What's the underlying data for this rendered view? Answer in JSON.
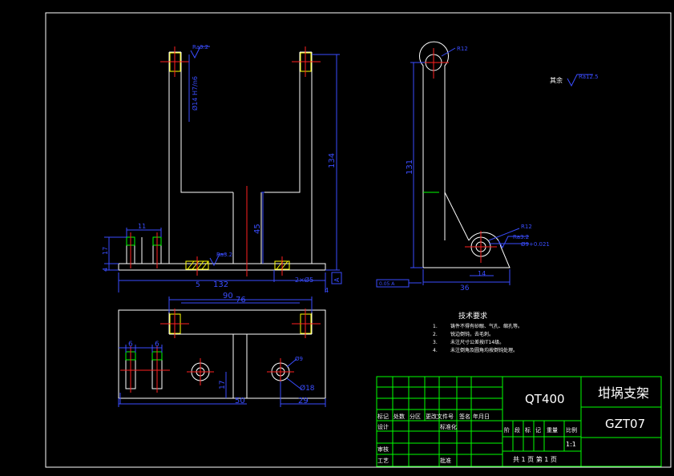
{
  "colors": {
    "background": "#000000",
    "part": "#ffffff",
    "dimension": "#3a4dff",
    "centerline": "#ff2020",
    "highlight": "#ffff00",
    "section": "#00ff00",
    "titleblock": "#00ff00"
  },
  "dimensions": {
    "front_width_132": "132",
    "front_inner_76": "76",
    "front_shaft_90": "90",
    "front_height_134": "134",
    "front_post_45": "45",
    "front_hole_fit": "Ø14 H7/n6",
    "front_base_17": "17",
    "front_base_4": "4",
    "front_lug_11": "11",
    "front_offset_5": "5",
    "front_right_4": "4",
    "front_chamfer": "2×Ø5",
    "side_height_131": "131",
    "side_width_36": "36",
    "side_r_top": "R12",
    "side_r_bottom": "R12",
    "side_hole_tol": "Ø9+0.021",
    "side_small_14": "14",
    "plan_6a": "6",
    "plan_6b": "6",
    "plan_17": "17",
    "plan_50": "50",
    "plan_29": "29",
    "plan_dia18": "Ø18",
    "plan_dia9": "Ø9",
    "roughness_front": "Ra3.2",
    "roughness_side": "Ra3.2",
    "roughness_other": "Ra12.5",
    "flatness_frame": "0.05 A",
    "datum_a": "A"
  },
  "notes": {
    "rest_label": "其余",
    "title": "技术要求",
    "items": [
      "1.",
      "铸件不得有砂眼、气孔、缩孔等。",
      "2.",
      "锐边倒钝，去毛刺。",
      "3.",
      "未注尺寸公差按IT14级。",
      "4.",
      "未注倒角及圆角均按倒钝处理。"
    ]
  },
  "title_block": {
    "material": "QT400",
    "part_name": "坩埚支架",
    "drawing_no": "GZT07",
    "row_header": [
      "标记",
      "处数",
      "分区",
      "更改文件号",
      "签名",
      "年月日"
    ],
    "design": "设计",
    "standardize": "标准化",
    "review": "审核",
    "process": "工艺",
    "approve": "批准",
    "stage_header": [
      "阶",
      "段",
      "标",
      "记",
      "重量",
      "比例"
    ],
    "scale": "1:1",
    "sheets": "共 1 页    第 1 页"
  }
}
